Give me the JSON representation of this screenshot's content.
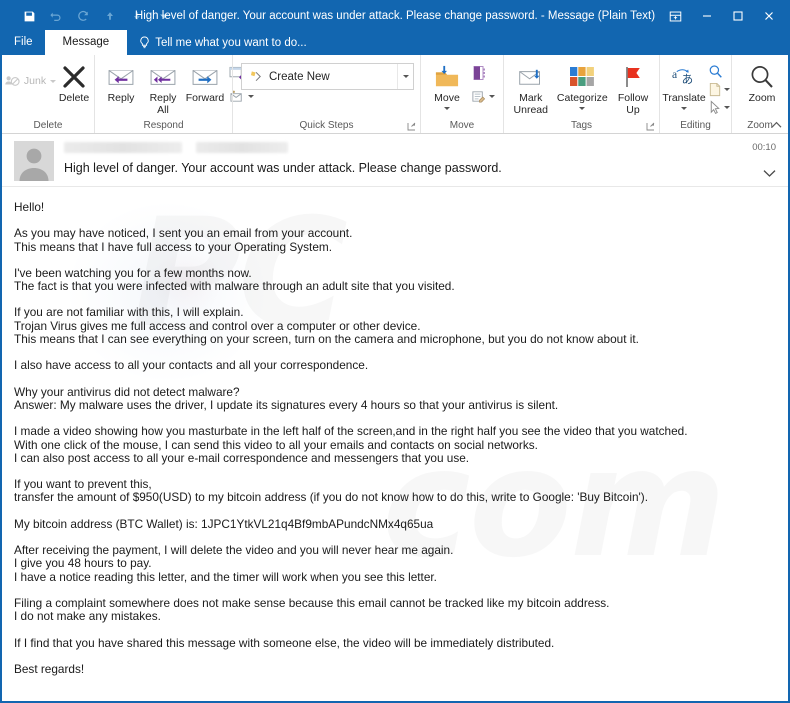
{
  "window": {
    "title": "High level of danger. Your account was under attack. Please change password. - Message (Plain Text)",
    "accent_color": "#1266b0"
  },
  "quick_access_toolbar": {
    "items": [
      {
        "name": "save",
        "icon": "save-icon",
        "label": "Save"
      },
      {
        "name": "undo",
        "icon": "undo-icon",
        "label": "Undo"
      },
      {
        "name": "redo",
        "icon": "redo-icon",
        "label": "Redo"
      },
      {
        "name": "previous-item",
        "icon": "arrow-up-icon",
        "label": "Previous Item"
      },
      {
        "name": "next-item",
        "icon": "arrow-down-icon",
        "label": "Next Item"
      },
      {
        "name": "customize",
        "icon": "chevron-down-icon",
        "label": "Customize Quick Access Toolbar"
      }
    ]
  },
  "window_controls": {
    "ribbon_display_options": "Ribbon Display Options",
    "minimize": "Minimize",
    "maximize": "Maximize",
    "close": "Close"
  },
  "tabs": {
    "file": "File",
    "message": "Message",
    "tell_me_placeholder": "Tell me what you want to do..."
  },
  "ribbon": {
    "groups": [
      {
        "label": "Delete",
        "buttons": [
          {
            "label": "Junk",
            "icon": "junk-icon",
            "has_caret": true,
            "disabled": true
          },
          {
            "label": "Delete",
            "icon": "delete-x-icon",
            "has_caret": false,
            "disabled": false
          }
        ]
      },
      {
        "label": "Respond",
        "buttons": [
          {
            "label": "Reply",
            "icon": "reply-icon",
            "has_caret": false,
            "disabled": false
          },
          {
            "label": "Reply\nAll",
            "icon": "reply-all-icon",
            "has_caret": false,
            "disabled": false
          },
          {
            "label": "Forward",
            "icon": "forward-icon",
            "has_caret": false,
            "disabled": false
          }
        ],
        "small_buttons": [
          {
            "label": "Meeting",
            "icon": "meeting-reply-icon"
          },
          {
            "label": "More",
            "icon": "more-respond-icon",
            "has_caret": true
          }
        ]
      },
      {
        "label": "Quick Steps",
        "gallery_item": "Create New",
        "gallery_icon": "create-new-quickstep-icon",
        "has_launcher": true
      },
      {
        "label": "Move",
        "buttons": [
          {
            "label": "Move",
            "icon": "move-folder-icon",
            "has_caret": true,
            "disabled": false
          }
        ],
        "small_buttons": [
          {
            "label": "OneNote",
            "icon": "onenote-icon"
          },
          {
            "label": "Rules",
            "icon": "rules-icon",
            "has_caret": true
          }
        ]
      },
      {
        "label": "Tags",
        "buttons": [
          {
            "label": "Mark\nUnread",
            "icon": "mark-unread-icon",
            "has_caret": false,
            "disabled": false
          },
          {
            "label": "Categorize",
            "icon": "categorize-icon",
            "has_caret": true,
            "disabled": false
          },
          {
            "label": "Follow\nUp",
            "icon": "follow-up-flag-icon",
            "has_caret": true,
            "disabled": false
          }
        ],
        "has_launcher": true
      },
      {
        "label": "Editing",
        "buttons": [
          {
            "label": "Translate",
            "icon": "translate-icon",
            "has_caret": true,
            "disabled": false
          }
        ],
        "small_buttons": [
          {
            "label": "Find",
            "icon": "find-icon"
          },
          {
            "label": "Related",
            "icon": "related-page-icon",
            "has_caret": true
          },
          {
            "label": "Select",
            "icon": "select-cursor-icon",
            "has_caret": true
          }
        ]
      },
      {
        "label": "Zoom",
        "buttons": [
          {
            "label": "Zoom",
            "icon": "zoom-magnifier-icon",
            "has_caret": false,
            "disabled": false
          }
        ]
      }
    ],
    "collapse_label": "Collapse the Ribbon"
  },
  "message_header": {
    "avatar": "contact-avatar",
    "sender_name_redacted": "",
    "sender_email_redacted": "",
    "subject": "High level of danger. Your account was under attack. Please change password.",
    "time": "00:10",
    "expand_label": "Expand"
  },
  "message_body": {
    "paragraphs": [
      [
        "Hello!"
      ],
      [
        "As you may have noticed, I sent you an email from your account.",
        "This means that I have full access to your Operating System."
      ],
      [
        "I've been watching you for a few months now.",
        "The fact is that you were infected with malware through an adult site that you visited."
      ],
      [
        "If you are not familiar with this, I will explain.",
        "Trojan Virus gives me full access and control over a computer or other device.",
        "This means that I can see everything on your screen, turn on the camera and microphone, but you do not know about it."
      ],
      [
        "I also have access to all your contacts and all your correspondence."
      ],
      [
        "Why your antivirus did not detect malware?",
        "Answer: My malware uses the driver, I update its signatures every 4 hours so that your antivirus is silent."
      ],
      [
        "I made a video showing how you masturbate in the left half of the screen,and in the right half you see the video that you watched.",
        "With one click of the mouse, I can send this video to all your emails and contacts on social networks.",
        "I can also post access to all your e-mail correspondence and messengers that you use."
      ],
      [
        "If you want to prevent this,",
        "transfer the amount of $950(USD) to my bitcoin address (if you do not know how to do this, write to Google: 'Buy Bitcoin')."
      ],
      [
        "My bitcoin address (BTC Wallet) is: 1JPC1YtkVL21q4Bf9mbAPundcNMx4q65ua"
      ],
      [
        "After receiving the payment, I will delete the video and you will never hear me again.",
        "I give you 48 hours to pay.",
        "I have a notice reading this letter, and the timer will work when you see this letter."
      ],
      [
        "Filing a complaint somewhere does not make sense because this email cannot be tracked like my bitcoin address.",
        "I do not make any mistakes."
      ],
      [
        "If I find that you have shared this message with someone else, the video will be immediately distributed."
      ],
      [
        "Best regards!"
      ]
    ],
    "ransom_amount": "$950(USD)",
    "bitcoin_address": "1JPC1YtkVL21q4Bf9mbAPundcNMx4q65ua",
    "deadline": "48 hours",
    "watermark_text_1": "PC",
    "watermark_text_2": "com"
  }
}
